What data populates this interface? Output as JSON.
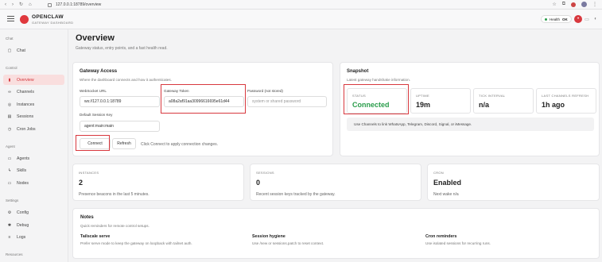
{
  "browser": {
    "url": "127.0.0.1:18789/overview"
  },
  "app": {
    "brand": "OPENCLAW",
    "subtitle": "GATEWAY DASHBOARD",
    "health_label": "Health",
    "health_value": "OK"
  },
  "sidebar": {
    "sections": [
      {
        "label": "Chat",
        "items": [
          {
            "label": "Chat",
            "icon": "chat-icon"
          }
        ]
      },
      {
        "label": "Control",
        "items": [
          {
            "label": "Overview",
            "icon": "chart-icon",
            "active": true
          },
          {
            "label": "Channels",
            "icon": "link-icon"
          },
          {
            "label": "Instances",
            "icon": "instances-icon"
          },
          {
            "label": "Sessions",
            "icon": "file-icon"
          },
          {
            "label": "Cron Jobs",
            "icon": "clock-icon"
          }
        ]
      },
      {
        "label": "Agent",
        "items": [
          {
            "label": "Agents",
            "icon": "folder-icon"
          },
          {
            "label": "Skills",
            "icon": "bolt-icon"
          },
          {
            "label": "Nodes",
            "icon": "monitor-icon"
          }
        ]
      },
      {
        "label": "Settings",
        "items": [
          {
            "label": "Config",
            "icon": "gear-icon"
          },
          {
            "label": "Debug",
            "icon": "bug-icon"
          },
          {
            "label": "Logs",
            "icon": "logs-icon"
          }
        ]
      },
      {
        "label": "Resources",
        "items": []
      }
    ]
  },
  "page": {
    "title": "Overview",
    "subtitle": "Gateway status, entry points, and a fast health read."
  },
  "access": {
    "title": "Gateway Access",
    "desc": "Where the dashboard connects and how it authenticates.",
    "ws_label": "WebSocket URL",
    "ws_value": "ws://127.0.0.1:18789",
    "token_label": "Gateway Token",
    "token_value": "a08a2af91aa30996616695e61d44",
    "password_label": "Password (not stored)",
    "password_placeholder": "system or shared password",
    "session_label": "Default Session Key",
    "session_value": "agent:main:main",
    "connect_label": "Connect",
    "refresh_label": "Refresh",
    "hint": "Click Connect to apply connection changes."
  },
  "snapshot": {
    "title": "Snapshot",
    "desc": "Latest gateway handshake information.",
    "tiles": [
      {
        "label": "STATUS",
        "value": "Connected",
        "status": "ok"
      },
      {
        "label": "UPTIME",
        "value": "19m"
      },
      {
        "label": "TICK INTERVAL",
        "value": "n/a"
      },
      {
        "label": "LAST CHANNELS REFRESH",
        "value": "1h ago"
      }
    ],
    "note": "Use Channels to link WhatsApp, Telegram, Discord, Signal, or iMessage."
  },
  "stats": [
    {
      "label": "INSTANCES",
      "value": "2",
      "desc": "Presence beacons in the last 5 minutes."
    },
    {
      "label": "SESSIONS",
      "value": "0",
      "desc": "Recent session keys tracked by the gateway."
    },
    {
      "label": "CRON",
      "value": "Enabled",
      "desc": "Next wake n/a"
    }
  ],
  "notes": {
    "title": "Notes",
    "desc": "Quick reminders for remote control setups.",
    "items": [
      {
        "title": "Tailscale serve",
        "text": "Prefer serve mode to keep the gateway on loopback with tailnet auth."
      },
      {
        "title": "Session hygiene",
        "text": "Use /new or sessions.patch to reset context."
      },
      {
        "title": "Cron reminders",
        "text": "Use isolated sessions for recurring runs."
      }
    ]
  },
  "colors": {
    "accent": "#d8383e",
    "ok": "#2a9d4b"
  }
}
